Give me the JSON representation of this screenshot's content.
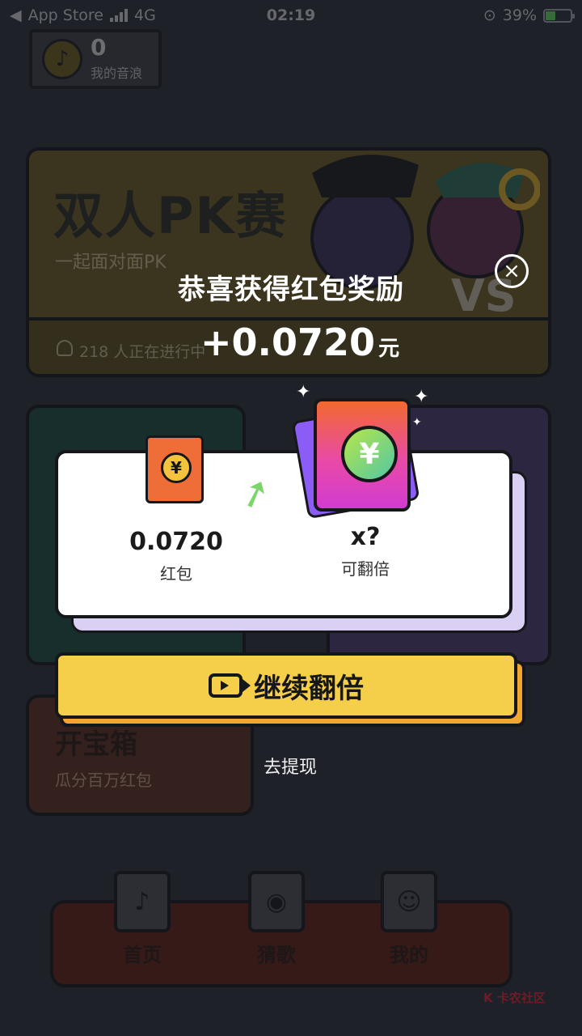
{
  "status_bar": {
    "back_app": "App Store",
    "network": "4G",
    "time": "02:19",
    "battery": "39%"
  },
  "header_chip": {
    "count": "0",
    "label": "我的音浪"
  },
  "pk_card": {
    "title": "双人PK赛",
    "subtitle": "一起面对面PK",
    "footer": "218 人正在进行中"
  },
  "treasure_card": {
    "title": "开宝箱",
    "subtitle": "瓜分百万红包"
  },
  "nav": {
    "items": [
      {
        "label": "首页"
      },
      {
        "label": "猜歌"
      },
      {
        "label": "我的"
      }
    ]
  },
  "modal": {
    "title": "恭喜获得红包奖励",
    "amount": "+0.0720",
    "unit": "元",
    "left_value": "0.0720",
    "left_label": "红包",
    "right_value": "x?",
    "right_label": "可翻倍",
    "cta_label": "继续翻倍",
    "withdraw_label": "去提现",
    "yen": "¥"
  },
  "colors": {
    "accent": "#f5cf4a",
    "overlay": "#2b2f39",
    "panel": "#ffffff"
  }
}
